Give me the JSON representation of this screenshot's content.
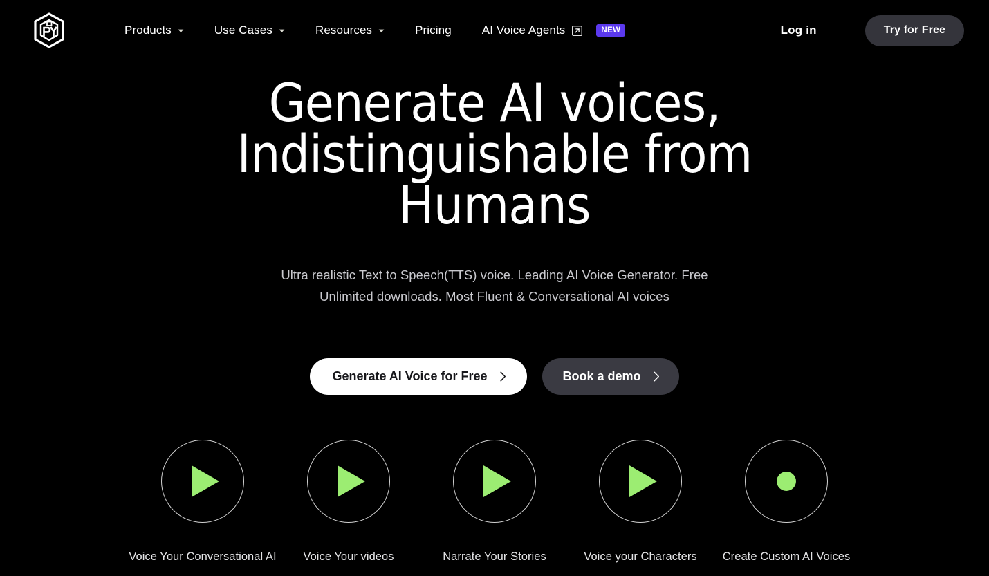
{
  "colors": {
    "background": "#000000",
    "accent_green": "#9CED72",
    "badge_purple": "#5B39EE",
    "button_dark": "#3A3A42",
    "button_light": "#ffffff",
    "text_primary": "#ffffff",
    "text_muted": "#C9C9CE"
  },
  "header": {
    "logo_name": "py-cube-logo",
    "nav_items": [
      {
        "label": "Products",
        "has_caret": true,
        "has_external": false,
        "badge": ""
      },
      {
        "label": "Use Cases",
        "has_caret": true,
        "has_external": false,
        "badge": ""
      },
      {
        "label": "Resources",
        "has_caret": true,
        "has_external": false,
        "badge": ""
      },
      {
        "label": "Pricing",
        "has_caret": false,
        "has_external": false,
        "badge": ""
      },
      {
        "label": "AI Voice Agents",
        "has_caret": false,
        "has_external": true,
        "badge": "NEW"
      }
    ],
    "login_label": "Log in",
    "try_free_label": "Try for Free"
  },
  "hero": {
    "headline_line_1": "Generate AI voices,",
    "headline_line_2": "Indistinguishable from",
    "headline_line_3": "Humans",
    "headline_full": "Generate AI voices, Indistinguishable from Humans",
    "subtitle": "Ultra realistic Text to Speech(TTS) voice. Leading AI Voice Generator. Free Unlimited downloads. Most Fluent & Conversational AI voices",
    "cta_primary": "Generate AI Voice for Free",
    "cta_secondary": "Book a demo"
  },
  "features": [
    {
      "label": "Voice Your Conversational AI",
      "icon": "play-icon"
    },
    {
      "label": "Voice Your videos",
      "icon": "play-icon"
    },
    {
      "label": "Narrate Your Stories",
      "icon": "play-icon"
    },
    {
      "label": "Voice your Characters",
      "icon": "play-icon"
    },
    {
      "label": "Create Custom AI Voices",
      "icon": "record-dot-icon"
    }
  ]
}
